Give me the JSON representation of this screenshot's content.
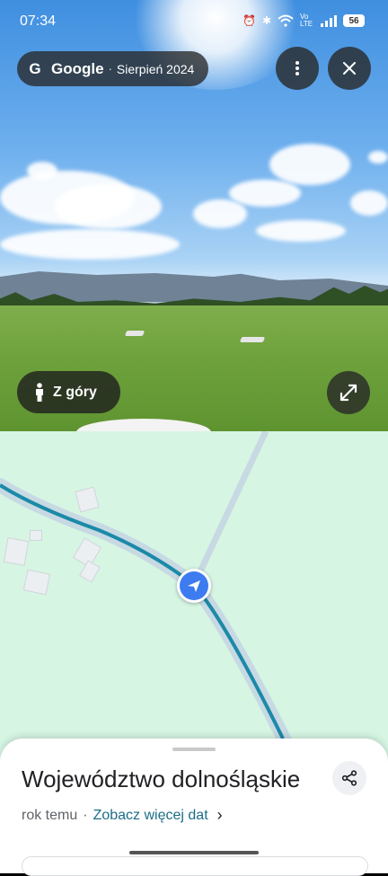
{
  "status_bar": {
    "time": "07:34",
    "battery": "56",
    "network_label": "Vo LTE"
  },
  "street_view": {
    "brand": "Google",
    "separator": "·",
    "capture_date": "Sierpień 2024",
    "aerial_button_label": "Z góry",
    "icons": {
      "more": "more-vert-icon",
      "close": "close-icon",
      "aerial": "person-icon",
      "expand": "expand-icon"
    }
  },
  "map": {
    "route_color": "#1b8aa8",
    "road_color": "#c7d9e3",
    "background": "#d6f5e3",
    "position_marker_color": "#3d7bf0"
  },
  "place_sheet": {
    "title": "Województwo dolnośląskie",
    "age": "rok temu",
    "separator": "·",
    "more_dates_link": "Zobacz więcej dat",
    "share_icon": "share-icon"
  }
}
